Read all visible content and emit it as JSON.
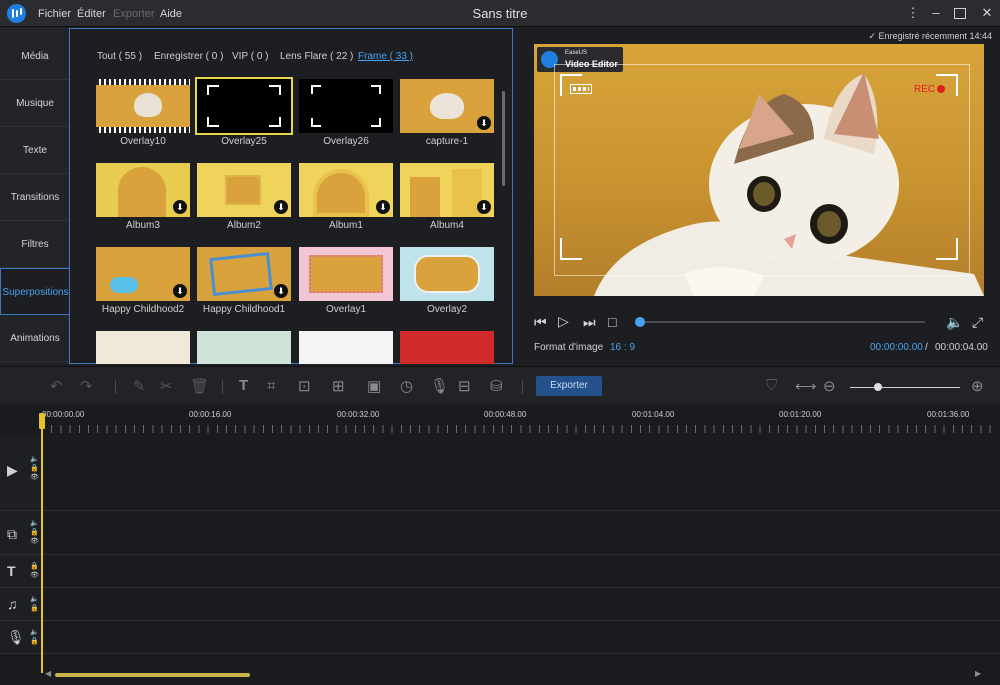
{
  "window": {
    "title": "Sans titre"
  },
  "menu": [
    "Fichier",
    "Éditer",
    "Exporter",
    "Aide"
  ],
  "sidebar": {
    "items": [
      {
        "label": "Média"
      },
      {
        "label": "Musique"
      },
      {
        "label": "Texte"
      },
      {
        "label": "Transitions"
      },
      {
        "label": "Filtres"
      },
      {
        "label": "Superpositions",
        "active": true
      },
      {
        "label": "Animations"
      }
    ]
  },
  "media": {
    "tabs": [
      {
        "label": "Tout ( 55 )"
      },
      {
        "label": "Enregistrer ( 0 )"
      },
      {
        "label": "VIP ( 0 )"
      },
      {
        "label": "Lens Flare ( 22 )"
      },
      {
        "label": "Frame ( 33 )",
        "active": true
      }
    ],
    "items": [
      {
        "label": "Overlay10"
      },
      {
        "label": "Overlay25",
        "selected": true
      },
      {
        "label": "Overlay26"
      },
      {
        "label": "capture-1",
        "download": true
      },
      {
        "label": "Album3",
        "download": true
      },
      {
        "label": "Album2",
        "download": true
      },
      {
        "label": "Album1",
        "download": true
      },
      {
        "label": "Album4",
        "download": true
      },
      {
        "label": "Happy Childhood2",
        "download": true
      },
      {
        "label": "Happy Childhood1",
        "download": true
      },
      {
        "label": "Overlay1"
      },
      {
        "label": "Overlay2"
      }
    ]
  },
  "preview": {
    "saved_status": "Enregistré récemment 14:44",
    "watermark_small": "EaseUS",
    "watermark_big": "Video Editor",
    "rec_label": "REC",
    "aspect_label": "Format d'image",
    "aspect_value": "16 : 9",
    "time_current": "00:00:00.00",
    "time_separator": "/",
    "time_total": "00:00:04.00"
  },
  "toolbar": {
    "export_label": "Exporter"
  },
  "timeline": {
    "timecodes": [
      "00:00:00.00",
      "00:00:16.00",
      "00:00:32.00",
      "00:00:48.00",
      "00:01:04.00",
      "00:01:20.00",
      "00:01:36.00"
    ]
  },
  "colors": {
    "accent": "#4aa3f0",
    "playhead": "#e6c229",
    "rec": "#e02020",
    "selection": "#e8d64a"
  }
}
